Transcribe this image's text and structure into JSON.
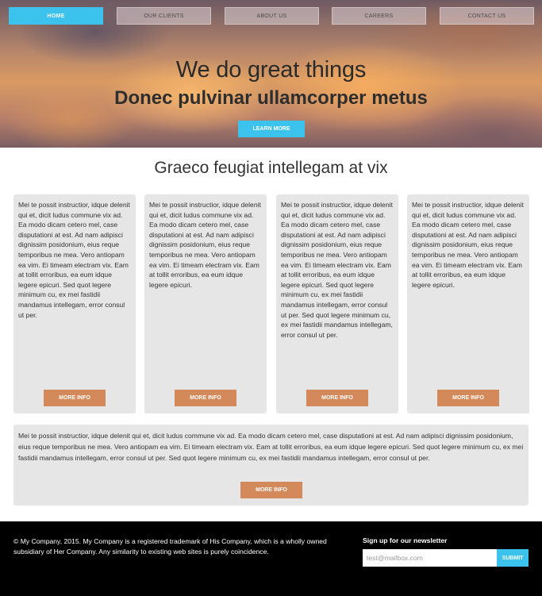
{
  "nav": {
    "items": [
      {
        "label": "HOME",
        "active": true
      },
      {
        "label": "OUR CLIENTS",
        "active": false
      },
      {
        "label": "ABOUT US",
        "active": false
      },
      {
        "label": "CAREERS",
        "active": false
      },
      {
        "label": "CONTACT US",
        "active": false
      }
    ]
  },
  "hero": {
    "title": "We do great things",
    "subtitle": "Donec pulvinar ullamcorper metus",
    "cta_label": "LEARN MORE"
  },
  "section": {
    "title": "Graeco feugiat intellegam at vix"
  },
  "cards": [
    {
      "text": "Mei te possit instructior, idque delenit qui et, dicit ludus commune vix ad. Ea modo dicam cetero mel, case disputationi at est. Ad nam adipisci dignissim posidonium, eius reque temporibus ne mea. Vero antiopam ea vim. Ei timeam electram vix. Eam at tollit erroribus, ea eum idque legere epicuri. Sed quot legere minimum cu, ex mei fastidii mandamus intellegam, error consul ut per.",
      "button_label": "MORE INFO"
    },
    {
      "text": "Mei te possit instructior, idque delenit qui et, dicit ludus commune vix ad. Ea modo dicam cetero mel, case disputationi at est. Ad nam adipisci dignissim posidonium, eius reque temporibus ne mea. Vero antiopam ea vim. Ei timeam electram vix. Eam at tollit erroribus, ea eum idque legere epicuri.",
      "button_label": "MORE INFO"
    },
    {
      "text": "Mei te possit instructior, idque delenit qui et, dicit ludus commune vix ad. Ea modo dicam cetero mel, case disputationi at est. Ad nam adipisci dignissim posidonium, eius reque temporibus ne mea. Vero antiopam ea vim. Ei timeam electram vix. Eam at tollit erroribus, ea eum idque legere epicuri. Sed quot legere minimum cu, ex mei fastidii mandamus intellegam, error consul ut per. Sed quot legere minimum cu, ex mei fastidii mandamus intellegam, error consul ut per.",
      "button_label": "MORE INFO"
    },
    {
      "text": "Mei te possit instructior, idque delenit qui et, dicit ludus commune vix ad. Ea modo dicam cetero mel, case disputationi at est. Ad nam adipisci dignissim posidonium, eius reque temporibus ne mea. Vero antiopam ea vim. Ei timeam electram vix. Eam at tollit erroribus, ea eum idque legere epicuri.",
      "button_label": "MORE INFO"
    }
  ],
  "wide_card": {
    "text": "Mei te possit instructior, idque delenit qui et, dicit ludus commune vix ad. Ea modo dicam cetero mel, case disputationi at est. Ad nam adipisci dignissim posidonium, eius reque temporibus ne mea. Vero antiopam ea vim. Ei timeam electram vix. Eam at tollit erroribus, ea eum idque legere epicuri. Sed quot legere minimum cu, ex mei fastidii mandamus intellegam, error consul ut per. Sed quot legere minimum cu, ex mei fastidii mandamus intellegam, error consul ut per.",
    "button_label": "MORE INFO"
  },
  "footer": {
    "copyright": "© My Company, 2015. My Company is a registered trademark of His Company, which is a wholly owned subsidiary of Her Company. Any similarity to existing web sites is purely coincidence.",
    "newsletter_title": "Sign up for our newsletter",
    "newsletter_placeholder": "test@mailbox.com",
    "submit_label": "SUBMIT"
  },
  "colors": {
    "accent": "#3bc3ee",
    "button": "#d4895a",
    "card_bg": "#e6e6e6",
    "footer_bg": "#000000"
  }
}
